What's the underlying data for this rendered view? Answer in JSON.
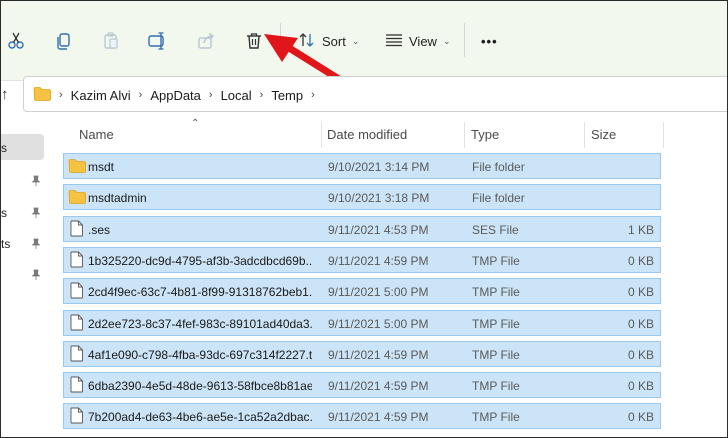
{
  "toolbar": {
    "buttons": [
      {
        "name": "cut-button",
        "icon": "scissors-icon"
      },
      {
        "name": "copy-button",
        "icon": "copy-icon"
      },
      {
        "name": "paste-button",
        "icon": "clipboard-icon"
      },
      {
        "name": "rename-button",
        "icon": "rename-icon"
      },
      {
        "name": "share-button",
        "icon": "share-icon"
      },
      {
        "name": "delete-button",
        "icon": "trash-icon"
      }
    ],
    "sort_label": "Sort",
    "view_label": "View",
    "more_label": "•••"
  },
  "address": {
    "crumbs": [
      "Kazim Alvi",
      "AppData",
      "Local",
      "Temp"
    ]
  },
  "nav": {
    "items": [
      "s",
      "s",
      "ts"
    ]
  },
  "columns": {
    "name": "Name",
    "date": "Date modified",
    "type": "Type",
    "size": "Size"
  },
  "files": [
    {
      "name": "msdt",
      "date": "9/10/2021 3:14 PM",
      "type": "File folder",
      "size": "",
      "kind": "folder"
    },
    {
      "name": "msdtadmin",
      "date": "9/10/2021 3:18 PM",
      "type": "File folder",
      "size": "",
      "kind": "folder"
    },
    {
      "name": ".ses",
      "date": "9/11/2021 4:53 PM",
      "type": "SES File",
      "size": "1 KB",
      "kind": "file"
    },
    {
      "name": "1b325220-dc9d-4795-af3b-3adcdbcd69b...",
      "date": "9/11/2021 4:59 PM",
      "type": "TMP File",
      "size": "0 KB",
      "kind": "file"
    },
    {
      "name": "2cd4f9ec-63c7-4b81-8f99-91318762beb1...",
      "date": "9/11/2021 5:00 PM",
      "type": "TMP File",
      "size": "0 KB",
      "kind": "file"
    },
    {
      "name": "2d2ee723-8c37-4fef-983c-89101ad40da3....",
      "date": "9/11/2021 5:00 PM",
      "type": "TMP File",
      "size": "0 KB",
      "kind": "file"
    },
    {
      "name": "4af1e090-c798-4fba-93dc-697c314f2227.t...",
      "date": "9/11/2021 4:59 PM",
      "type": "TMP File",
      "size": "0 KB",
      "kind": "file"
    },
    {
      "name": "6dba2390-4e5d-48de-9613-58fbce8b81ae...",
      "date": "9/11/2021 4:59 PM",
      "type": "TMP File",
      "size": "0 KB",
      "kind": "file"
    },
    {
      "name": "7b200ad4-de63-4be6-ae5e-1ca52a2dbac...",
      "date": "9/11/2021 4:59 PM",
      "type": "TMP File",
      "size": "0 KB",
      "kind": "file"
    }
  ],
  "colors": {
    "selection": "#cce4f7",
    "selection_border": "#99c9ef",
    "annotation_arrow": "#e0161b",
    "folder": "#f5c242"
  }
}
